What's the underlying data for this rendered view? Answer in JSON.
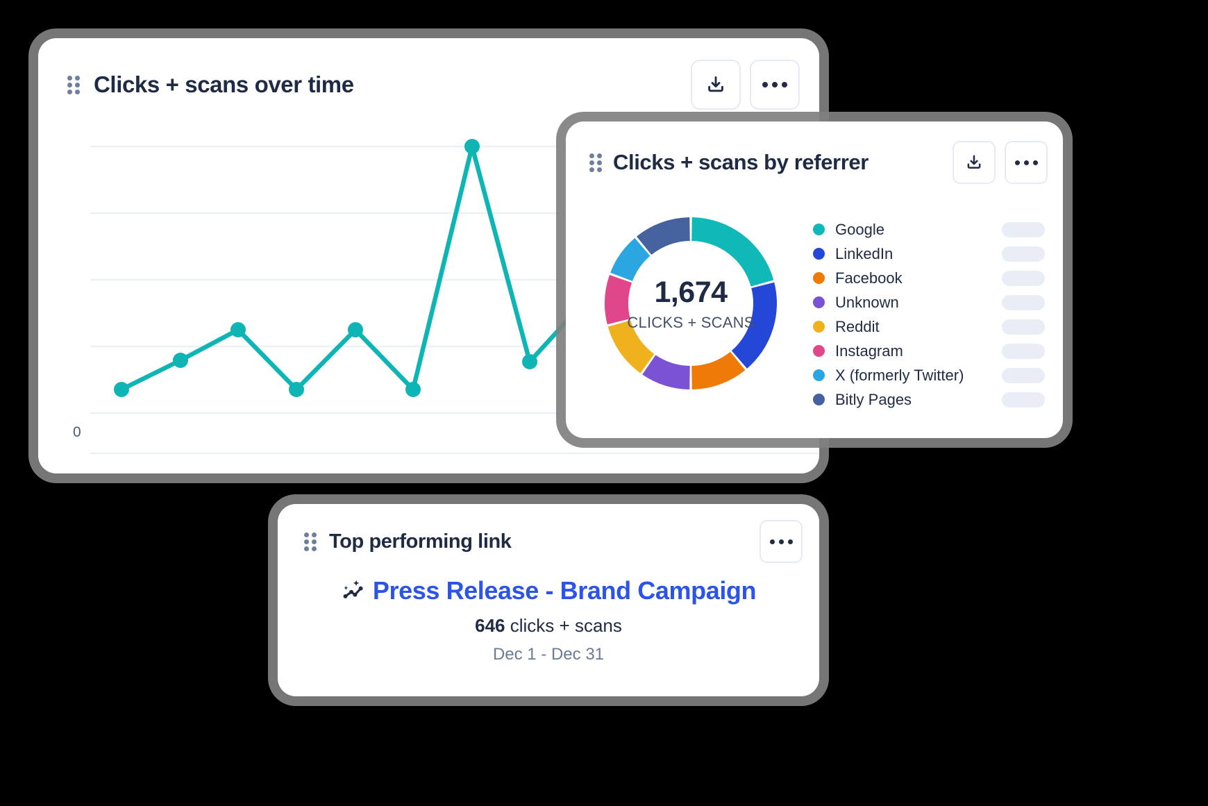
{
  "cards": {
    "line": {
      "title": "Clicks + scans over time",
      "drag_handle_icon": "drag-dots-icon",
      "download_icon": "download-icon",
      "more_icon": "more-horizontal-icon",
      "axis_zero_label": "0"
    },
    "referrer": {
      "title": "Clicks + scans by referrer",
      "drag_handle_icon": "drag-dots-icon",
      "download_icon": "download-icon",
      "more_icon": "more-horizontal-icon",
      "total": "1,674",
      "total_caption": "CLICKS + SCANS"
    },
    "top_link": {
      "title": "Top performing link",
      "drag_handle_icon": "drag-dots-icon",
      "more_icon": "more-horizontal-icon",
      "trend_icon": "trend-sparkle-icon",
      "link_label": "Press Release - Brand Campaign",
      "metric_value": "646",
      "metric_label": " clicks + scans",
      "date_range": "Dec 1 - Dec 31"
    }
  },
  "colors": {
    "line_series": "#0fb5b5",
    "link_blue": "#2c54e8",
    "text_dark": "#1f2a44",
    "text_muted": "#6b7a95",
    "gridline": "#eef1f6",
    "card_shadow": "#808080",
    "pill_gray": "#e9edf5"
  },
  "chart_data": [
    {
      "type": "line",
      "title": "Clicks + scans over time",
      "xlabel": "",
      "ylabel": "",
      "grid": true,
      "gridlines": 5,
      "ylim": [
        0,
        100
      ],
      "ytick_labels": [
        "0"
      ],
      "series": [
        {
          "name": "Clicks + scans",
          "color": "#0fb5b5",
          "x": [
            1,
            2,
            3,
            4,
            5,
            6,
            7,
            8,
            9
          ],
          "values": [
            18,
            27,
            37,
            18,
            37,
            18,
            96,
            27,
            55
          ]
        }
      ]
    },
    {
      "type": "pie",
      "variant": "donut",
      "title": "Clicks + scans by referrer",
      "total": 1674,
      "total_caption": "CLICKS + SCANS",
      "legend_position": "right",
      "categories": [
        "Google",
        "LinkedIn",
        "Facebook",
        "Unknown",
        "Reddit",
        "Instagram",
        "X (formerly Twitter)",
        "Bitly Pages"
      ],
      "values": [
        349,
        302,
        186,
        163,
        186,
        163,
        140,
        185
      ],
      "percentages": [
        20.8,
        18.1,
        11.1,
        9.7,
        11.1,
        9.7,
        8.4,
        11.1
      ],
      "colors": [
        "#11b8b8",
        "#2547d8",
        "#ee7a08",
        "#7b52d3",
        "#efb21e",
        "#e0468a",
        "#2ba6e0",
        "#45629f"
      ],
      "legend": [
        {
          "label": "Google",
          "color": "#11b8b8",
          "value_placeholder": true
        },
        {
          "label": "LinkedIn",
          "color": "#2547d8",
          "value_placeholder": true
        },
        {
          "label": "Facebook",
          "color": "#ee7a08",
          "value_placeholder": true
        },
        {
          "label": "Unknown",
          "color": "#7b52d3",
          "value_placeholder": true
        },
        {
          "label": "Reddit",
          "color": "#efb21e",
          "value_placeholder": true
        },
        {
          "label": "Instagram",
          "color": "#e0468a",
          "value_placeholder": true
        },
        {
          "label": "X (formerly Twitter)",
          "color": "#2ba6e0",
          "value_placeholder": true
        },
        {
          "label": "Bitly Pages",
          "color": "#45629f",
          "value_placeholder": true
        }
      ]
    }
  ]
}
